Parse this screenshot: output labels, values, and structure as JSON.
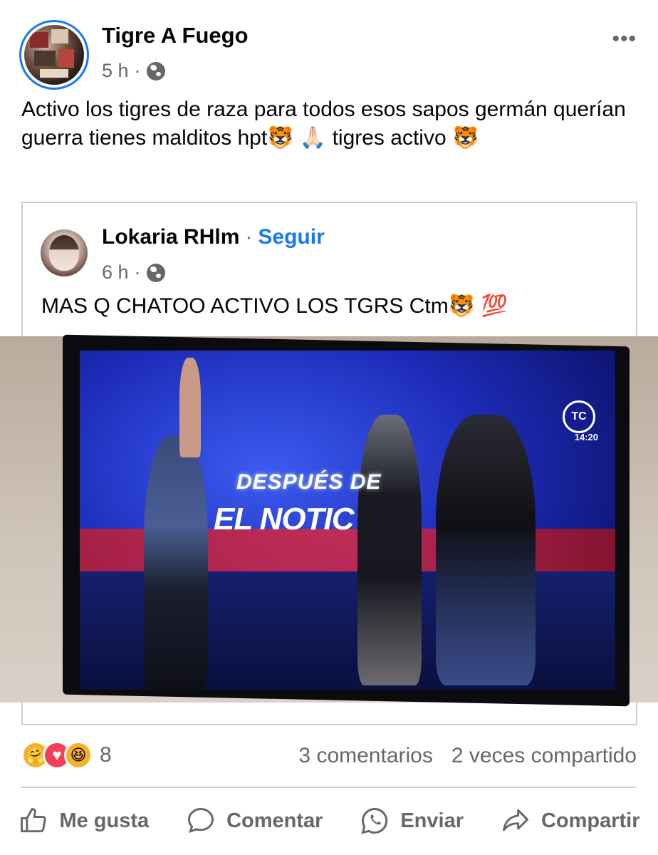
{
  "post": {
    "author": "Tigre A Fuego",
    "time": "5 h",
    "separator": "·",
    "privacy_icon": "globe-icon",
    "more_icon": "•••",
    "text": "Activo los tigres de raza para todos esos sapos germán querían guerra tienes malditos hpt🐯 🙏🏻 tigres activo 🐯"
  },
  "shared_post": {
    "author": "Lokaria RHlm",
    "dot": "·",
    "follow_label": "Seguir",
    "time": "6 h",
    "separator": "·",
    "privacy_icon": "globe-icon",
    "text": "MAS Q CHATOO ACTIVO LOS TGRS Ctm🐯 💯",
    "image": {
      "tv_logo_top": "DESPUÉS DE",
      "tv_logo_bottom": "EL NOTIC",
      "channel_logo": "TC",
      "clock": "14:20"
    }
  },
  "reactions": {
    "icons": [
      "care-reaction-icon",
      "love-reaction-icon",
      "haha-reaction-icon"
    ],
    "count": "8",
    "comments": "3 comentarios",
    "shares": "2 veces compartido"
  },
  "actions": {
    "like": "Me gusta",
    "comment": "Comentar",
    "send": "Enviar",
    "share": "Compartir"
  },
  "colors": {
    "accent": "#1877f2",
    "secondary_text": "#65676b",
    "divider": "#ced0d4"
  }
}
